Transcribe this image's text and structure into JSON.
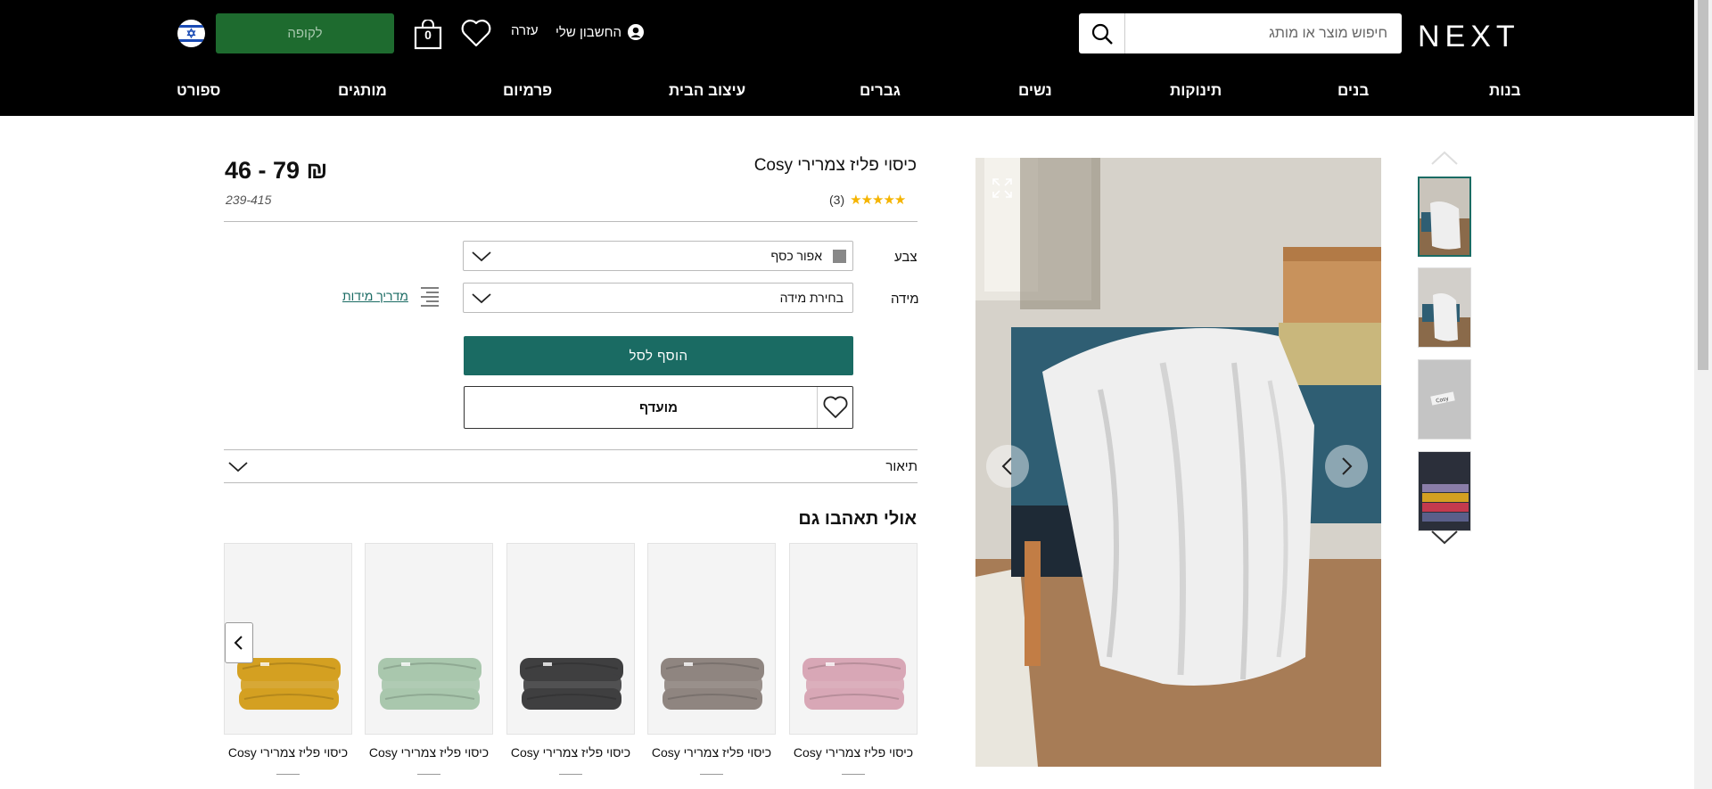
{
  "header": {
    "logo": "NEXT",
    "search_placeholder": "חיפוש מוצר או מותג",
    "account_label": "החשבון שלי",
    "help_label": "עזרה",
    "bag_count": "0",
    "checkout_label": "לקופה"
  },
  "nav": [
    "בנות",
    "בנים",
    "תינוקות",
    "נשים",
    "גברים",
    "עיצוב הבית",
    "פרמיום",
    "מותגים",
    "ספורט"
  ],
  "product": {
    "title": "כיסוי פליז צמרירי Cosy",
    "price": "46 - 79 ₪",
    "stars": "★★★★★",
    "review_count": "(3)",
    "sku": "239-415",
    "color_label": "צבע",
    "color_value": "אפור כסף",
    "color_swatch": "#888888",
    "size_label": "מידה",
    "size_value": "בחירת מידה",
    "size_guide": "מדריך מידות",
    "add_to_bag": "הוסף לסל",
    "favourite": "מועדף",
    "description": "תיאור"
  },
  "recommendations": {
    "title": "אולי תאהבו גם",
    "items": [
      {
        "label": "כיסוי פליז צמרירי Cosy",
        "color": "#d8a7b6"
      },
      {
        "label": "כיסוי פליז צמרירי Cosy",
        "color": "#8f8580"
      },
      {
        "label": "כיסוי פליז צמרירי Cosy",
        "color": "#3f3f40"
      },
      {
        "label": "כיסוי פליז צמרירי Cosy",
        "color": "#a9c7ad"
      },
      {
        "label": "כיסוי פליז צמרירי Cosy",
        "color": "#d4a021"
      }
    ]
  },
  "colors": {
    "accent": "#1a6b63",
    "checkout_green": "#1e6b2f",
    "header_bg": "#000000"
  }
}
